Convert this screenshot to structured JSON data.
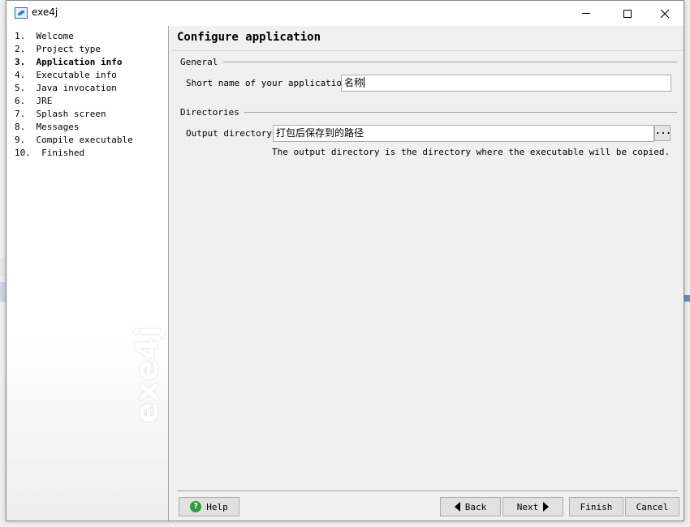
{
  "window": {
    "title": "exe4j"
  },
  "nav": {
    "items": [
      {
        "label": "1.  Welcome",
        "active": false
      },
      {
        "label": "2.  Project type",
        "active": false
      },
      {
        "label": "3.  Application info",
        "active": true
      },
      {
        "label": "4.  Executable info",
        "active": false
      },
      {
        "label": "5.  Java invocation",
        "active": false
      },
      {
        "label": "6.  JRE",
        "active": false
      },
      {
        "label": "7.  Splash screen",
        "active": false
      },
      {
        "label": "8.  Messages",
        "active": false
      },
      {
        "label": "9.  Compile executable",
        "active": false
      },
      {
        "label": "10.  Finished",
        "active": false
      }
    ],
    "watermark": "exe4j"
  },
  "page": {
    "title": "Configure application",
    "general": {
      "group_label": "General",
      "short_name_label": "Short name of your application:",
      "short_name_value": "名称"
    },
    "directories": {
      "group_label": "Directories",
      "output_label": "Output directory:",
      "output_value": "打包后保存到的路径",
      "browse_label": "...",
      "hint": "The output directory is the directory where the executable will be copied."
    }
  },
  "buttons": {
    "help": "Help",
    "back": "Back",
    "next": "Next",
    "finish": "Finish",
    "cancel": "Cancel"
  },
  "colors": {
    "help_icon": "#2e9e3a",
    "window_bg": "#f0f0f0"
  }
}
